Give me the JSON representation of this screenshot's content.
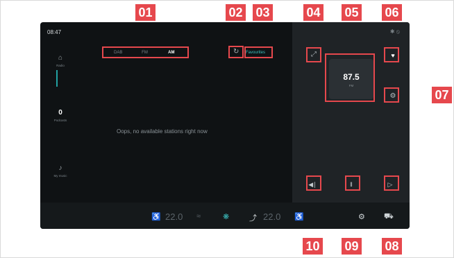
{
  "status": {
    "time": "08:47",
    "icons": "✱ ⦸"
  },
  "sidebar": {
    "items": [
      {
        "icon": "radio-icon",
        "glyph": "⌂",
        "label": "Radio"
      },
      {
        "icon": "podcast-icon",
        "glyph": "0",
        "label": "Podcasts"
      },
      {
        "icon": "my-music-icon",
        "glyph": "♪",
        "label": "My music"
      }
    ]
  },
  "radio": {
    "bands": [
      "DAB",
      "FM",
      "AM"
    ],
    "selected_band": "AM",
    "favourites_label": "Favourites",
    "empty_message": "Oops, no available stations right now",
    "frequency": "87.5",
    "frequency_band": "FM"
  },
  "climate": {
    "left_temp": "22.0",
    "right_temp": "22.0"
  },
  "callouts": [
    "01",
    "02",
    "03",
    "04",
    "05",
    "06",
    "07",
    "08",
    "09",
    "10"
  ],
  "colors": {
    "accent": "#3cc0c0",
    "callout": "#e6484d",
    "background": "#0f1214"
  }
}
